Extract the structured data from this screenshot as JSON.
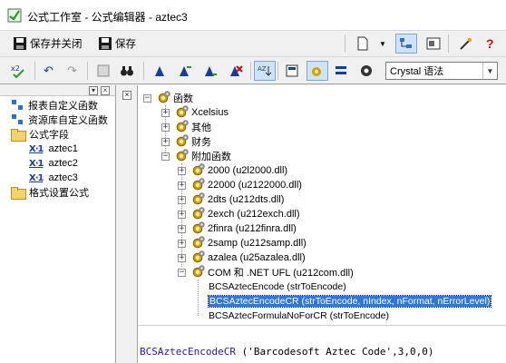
{
  "window": {
    "title": "公式工作室 - 公式编辑器 - aztec3"
  },
  "toolbar1": {
    "save_close_label": "保存并关闭",
    "save_label": "保存"
  },
  "toolbar2": {
    "syntax_value": "Crystal 语法"
  },
  "left_tree": {
    "items": [
      {
        "label": "报表自定义函数"
      },
      {
        "label": "资源库自定义函数"
      },
      {
        "label": "公式字段"
      },
      {
        "label": "aztec1"
      },
      {
        "label": "aztec2"
      },
      {
        "label": "aztec3"
      },
      {
        "label": "格式设置公式"
      }
    ]
  },
  "func_tree": {
    "root": "函数",
    "nodes": [
      "Xcelsius",
      "其他",
      "财务",
      "附加函数",
      "2000 (u2l2000.dll)",
      "22000 (u2122000.dll)",
      "2dts (u212dts.dll)",
      "2exch (u212exch.dll)",
      "2finra (u212finra.dll)",
      "2samp (u212samp.dll)",
      "azalea (u25azalea.dll)",
      "COM 和 .NET UFL (u212com.dll)",
      "BCSAztecEncode (strToEncode)",
      "BCSAztecEncodeCR (strToEncode, nIndex, nFormat, nErrorLevel)",
      "BCSAztecFormulaNoForCR (strToEncode)"
    ]
  },
  "editor": {
    "function_name": "BCSAztecEncodeCR",
    "args": " ('Barcodesoft Aztec Code',3,0,0)"
  },
  "colors": {
    "selection": "#3078d8",
    "code_function": "#1b1bbf"
  }
}
